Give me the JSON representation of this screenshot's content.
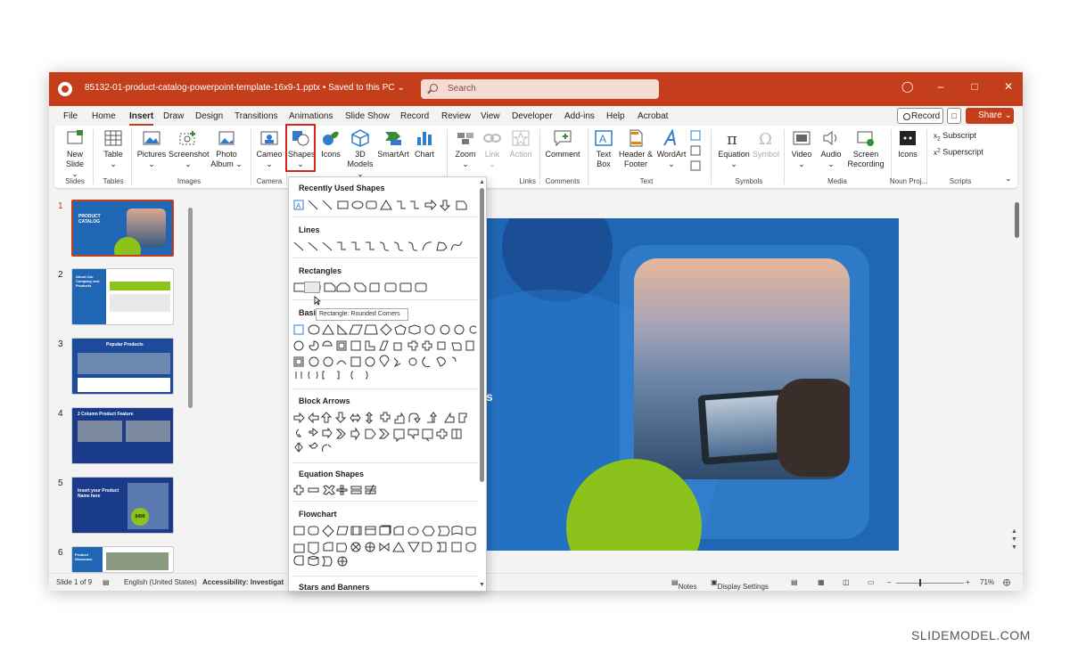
{
  "titlebar": {
    "doc_title": "85132-01-product-catalog-powerpoint-template-16x9-1.pptx • Saved to this PC ⌄",
    "search_placeholder": "Search",
    "icons": [
      "lightbulb-icon",
      "minimize-icon",
      "maximize-icon",
      "close-icon"
    ]
  },
  "menu": {
    "tabs": [
      "File",
      "Home",
      "Insert",
      "Draw",
      "Design",
      "Transitions",
      "Animations",
      "Slide Show",
      "Record",
      "Review",
      "View",
      "Developer",
      "Add-ins",
      "Help",
      "Acrobat"
    ],
    "active_tab": "Insert",
    "record_label": "Record",
    "share_label": "Share ⌄"
  },
  "ribbon": {
    "buttons": {
      "new_slide": "New Slide ⌄",
      "table": "Table ⌄",
      "pictures": "Pictures ⌄",
      "screenshot": "Screenshot ⌄",
      "photo_album": "Photo Album ⌄",
      "cameo": "Cameo ⌄",
      "shapes": "Shapes ⌄",
      "icons": "Icons",
      "models3d": "3D Models ⌄",
      "smartart": "SmartArt",
      "chart": "Chart",
      "zoom": "Zoom ⌄",
      "link": "Link ⌄",
      "action": "Action",
      "comment": "Comment",
      "text_box": "Text Box",
      "header_footer": "Header & Footer",
      "wordart": "WordArt ⌄",
      "equation": "Equation ⌄",
      "symbol": "Symbol",
      "video": "Video ⌄",
      "audio": "Audio ⌄",
      "screen_recording": "Screen Recording",
      "icons2": "Icons",
      "subscript": "Subscript",
      "superscript": "Superscript"
    },
    "groups": {
      "slides": "Slides",
      "tables": "Tables",
      "images": "Images",
      "camera": "Camera",
      "links": "Links",
      "comments": "Comments",
      "text": "Text",
      "symbols": "Symbols",
      "media": "Media",
      "noun_project": "Noun Proj...",
      "scripts": "Scripts"
    }
  },
  "slides": {
    "numbers": [
      "1",
      "2",
      "3",
      "4",
      "5",
      "6"
    ],
    "thumb_text": {
      "s1_title": "PRODUCT CATALOG",
      "s2_title": "About Our Company and Products",
      "s3_title": "Popular Products",
      "s4_title": "2 Column Product Feature",
      "s5_title": "Insert your Product Name here",
      "s5_price": "$499",
      "s6_title": "Product Showcase"
    }
  },
  "slide_partial_text": "s",
  "shapes_menu": {
    "sections": [
      "Recently Used Shapes",
      "Lines",
      "Rectangles",
      "Basic Shapes",
      "Block Arrows",
      "Equation Shapes",
      "Flowchart",
      "Stars and Banners"
    ],
    "tooltip": "Rectangle: Rounded Corners"
  },
  "status": {
    "slide": "Slide 1 of 9",
    "language": "English (United States)",
    "accessibility": "Accessibility: Investigat",
    "notes": "Notes",
    "display": "Display Settings",
    "zoom": "71%"
  },
  "watermark": "SLIDEMODEL.COM",
  "colors": {
    "accent": "#c43e1c",
    "slide_blue": "#1f66b4",
    "green": "#8cc21c"
  }
}
